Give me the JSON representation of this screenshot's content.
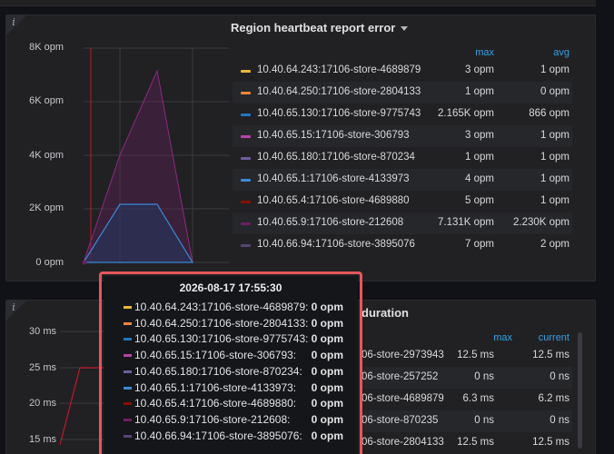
{
  "colors": {
    "bg": "#111217",
    "panel": "#212124",
    "accent_blue": "#33a2e5",
    "tooltip_border": "#e5575c"
  },
  "panel1": {
    "title": "Region heartbeat report error",
    "info_icon": "info-icon",
    "legend_headers": {
      "max": "max",
      "avg": "avg"
    },
    "y_ticks": [
      "8K opm",
      "6K opm",
      "4K opm",
      "2K opm",
      "0 opm"
    ],
    "legend": [
      {
        "name": "10.40.64.243:17106-store-4689879",
        "max": "3 opm",
        "avg": "1 opm",
        "color": "#eab839"
      },
      {
        "name": "10.40.64.250:17106-store-2804133",
        "max": "1 opm",
        "avg": "0 opm",
        "color": "#ef843c"
      },
      {
        "name": "10.40.65.130:17106-store-9775743",
        "max": "2.165K opm",
        "avg": "866 opm",
        "color": "#1f78c1"
      },
      {
        "name": "10.40.65.15:17106-store-306793",
        "max": "3 opm",
        "avg": "1 opm",
        "color": "#ba43a9"
      },
      {
        "name": "10.40.65.180:17106-store-870234",
        "max": "1 opm",
        "avg": "1 opm",
        "color": "#705da0"
      },
      {
        "name": "10.40.65.1:17106-store-4133973",
        "max": "4 opm",
        "avg": "1 opm",
        "color": "#508642"
      },
      {
        "name": "10.40.65.4:17106-store-4689880",
        "max": "5 opm",
        "avg": "1 opm",
        "color": "#890f02"
      },
      {
        "name": "10.40.65.9:17106-store-212608",
        "max": "7.131K opm",
        "avg": "2.230K opm",
        "color": "#6d1f62"
      },
      {
        "name": "10.40.66.94:17106-store-3895076",
        "max": "7 opm",
        "avg": "2 opm",
        "color": "#584477"
      }
    ]
  },
  "panel2": {
    "title_fragment": "duration",
    "info_icon": "info-icon",
    "legend_headers": {
      "max": "max",
      "current": "current"
    },
    "y_ticks": [
      "30 ms",
      "25 ms",
      "20 ms",
      "15 ms"
    ],
    "legend": [
      {
        "name": "06-store-2973943",
        "max": "12.5 ms",
        "current": "12.5 ms"
      },
      {
        "name": "06-store-257252",
        "max": "0 ns",
        "current": "0 ns"
      },
      {
        "name": "06-store-4689879",
        "max": "6.3 ms",
        "current": "6.2 ms"
      },
      {
        "name": "06-store-870235",
        "max": "0 ns",
        "current": "0 ns"
      },
      {
        "name": "06-store-2804133",
        "max": "12.5 ms",
        "current": "12.5 ms"
      }
    ]
  },
  "tooltip": {
    "time": "2026-08-17 17:55:30",
    "rows": [
      {
        "name": "10.40.64.243:17106-store-4689879:",
        "value": "0 opm",
        "color": "#eab839"
      },
      {
        "name": "10.40.64.250:17106-store-2804133:",
        "value": "0 opm",
        "color": "#ef843c"
      },
      {
        "name": "10.40.65.130:17106-store-9775743:",
        "value": "0 opm",
        "color": "#1f78c1"
      },
      {
        "name": "10.40.65.15:17106-store-306793:",
        "value": "0 opm",
        "color": "#ba43a9"
      },
      {
        "name": "10.40.65.180:17106-store-870234:",
        "value": "0 opm",
        "color": "#705da0"
      },
      {
        "name": "10.40.65.1:17106-store-4133973:",
        "value": "0 opm",
        "color": "#508642"
      },
      {
        "name": "10.40.65.4:17106-store-4689880:",
        "value": "0 opm",
        "color": "#890f02"
      },
      {
        "name": "10.40.65.9:17106-store-212608:",
        "value": "0 opm",
        "color": "#6d1f62"
      },
      {
        "name": "10.40.66.94:17106-store-3895076:",
        "value": "0 opm",
        "color": "#584477"
      }
    ]
  }
}
